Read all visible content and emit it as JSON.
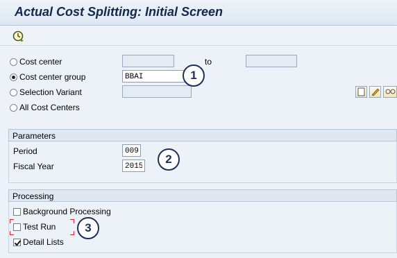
{
  "window": {
    "title": "Actual Cost Splitting: Initial Screen"
  },
  "toolbar": {
    "execute_icon": "execute-clock-icon"
  },
  "selection": {
    "cost_center": {
      "label": "Cost center",
      "from_value": "",
      "to_label": "to",
      "to_value": "",
      "selected": false
    },
    "cost_center_group": {
      "label": "Cost center group",
      "value": "BBAI",
      "selected": true
    },
    "selection_variant": {
      "label": "Selection Variant",
      "value": "",
      "selected": false,
      "actions": [
        "create-icon",
        "change-icon",
        "display-icon"
      ]
    },
    "all_cost_centers": {
      "label": "All Cost Centers",
      "selected": false
    }
  },
  "parameters": {
    "header": "Parameters",
    "period_label": "Period",
    "period_value": "009",
    "fiscal_year_label": "Fiscal Year",
    "fiscal_year_value": "2015"
  },
  "processing": {
    "header": "Processing",
    "background_label": "Background Processing",
    "background_checked": false,
    "test_run_label": "Test Run",
    "test_run_checked": false,
    "detail_lists_label": "Detail Lists",
    "detail_lists_checked": true
  },
  "callouts": [
    "1",
    "2",
    "3"
  ],
  "colors": {
    "title": "#14284b",
    "background": "#edf2f8",
    "callout": "#1e2f55",
    "highlight": "#e0262e"
  }
}
